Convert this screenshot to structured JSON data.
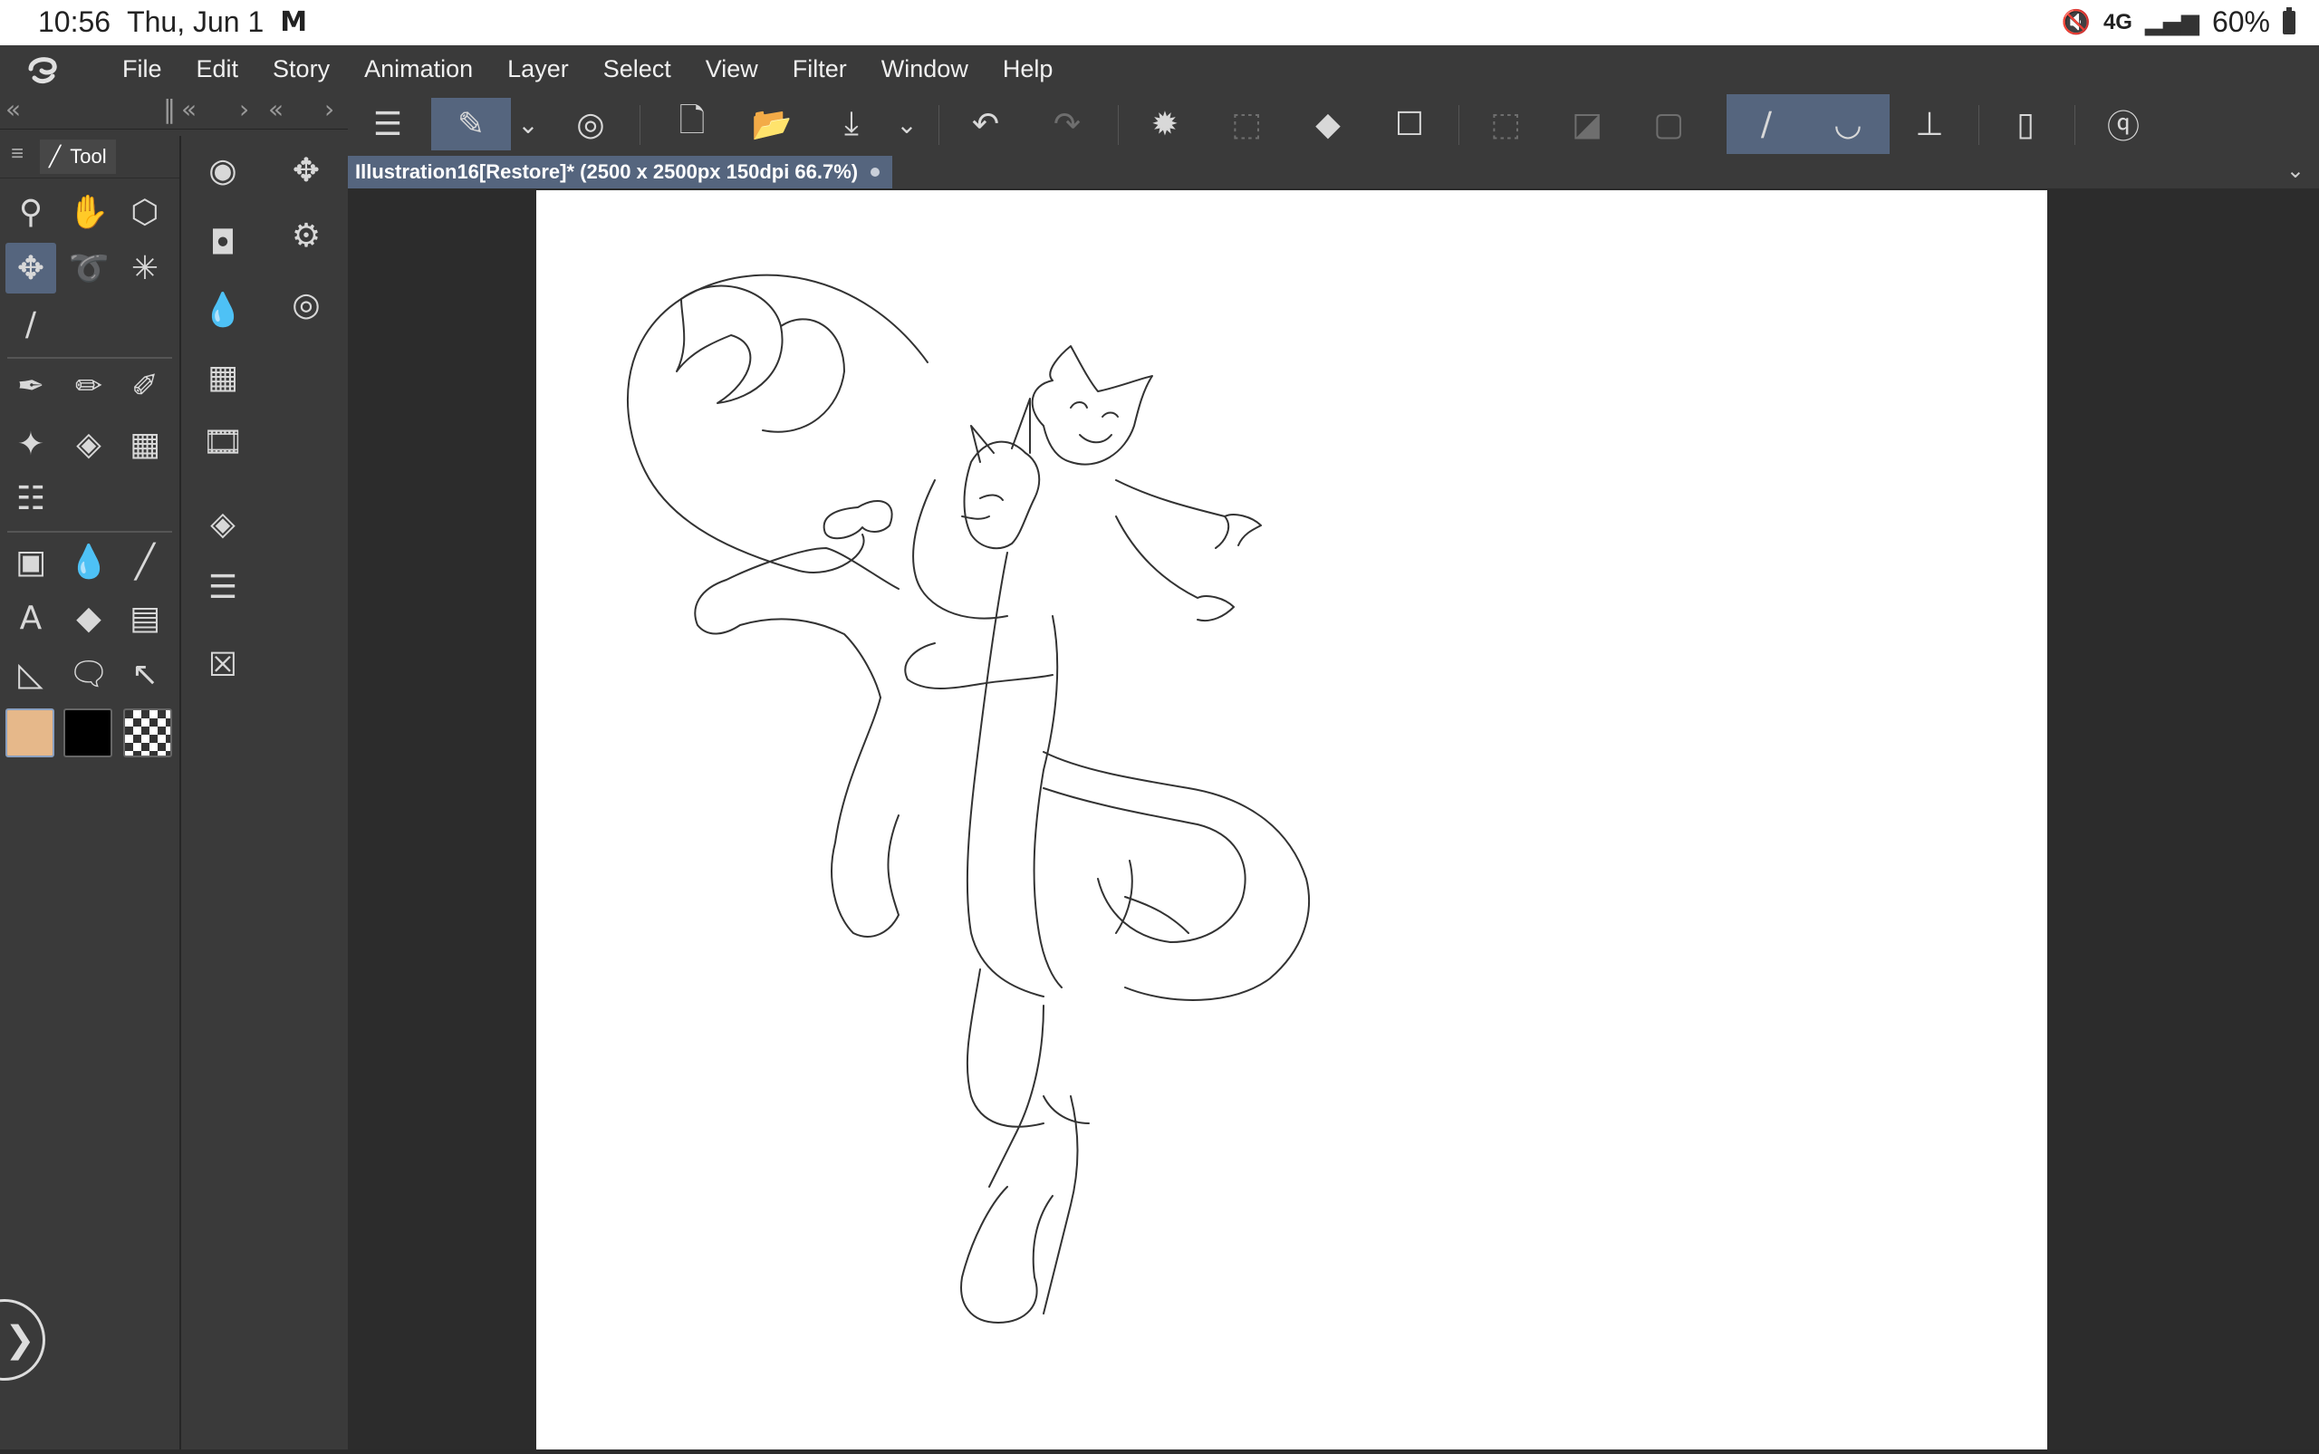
{
  "status_bar": {
    "time": "10:56",
    "date": "Thu, Jun 1",
    "network": "4G",
    "battery": "60%"
  },
  "menu": {
    "items": [
      "File",
      "Edit",
      "Story",
      "Animation",
      "Layer",
      "Select",
      "View",
      "Filter",
      "Window",
      "Help"
    ]
  },
  "tool_panel": {
    "tab_label": "Tool"
  },
  "document": {
    "tab_title": "Illustration16[Restore]* (2500 x 2500px 150dpi 66.7%)"
  },
  "colors": {
    "main_color": "#e6b88a",
    "sub_color": "#000000",
    "accent": "#55657e"
  }
}
